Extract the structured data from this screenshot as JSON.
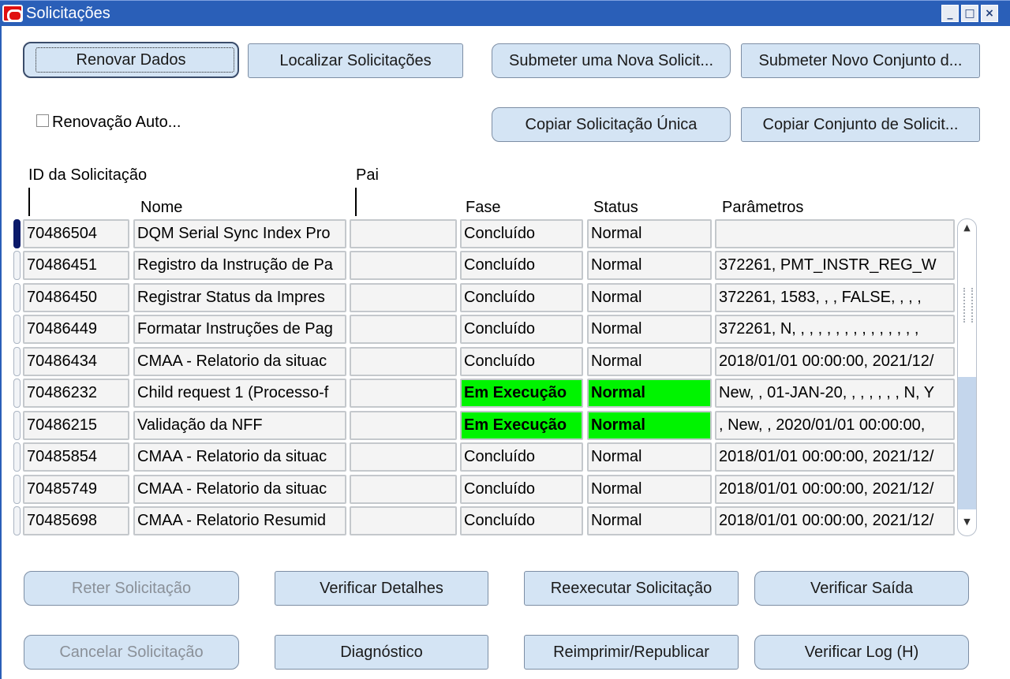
{
  "window": {
    "title": "Solicitações",
    "minimize_glyph": "_",
    "maximize_glyph": "□",
    "close_glyph": "×"
  },
  "buttons": {
    "renovar": "Renovar Dados",
    "localizar": "Localizar Solicitações",
    "submeter_nova": "Submeter uma Nova Solicit...",
    "submeter_conjunto": "Submeter Novo Conjunto d...",
    "copiar_unica": "Copiar Solicitação Única",
    "copiar_conjunto": "Copiar Conjunto de Solicit...",
    "reter": "Reter Solicitação",
    "verificar_detalhes": "Verificar Detalhes",
    "reexecutar": "Reexecutar Solicitação",
    "verificar_saida": "Verificar Saída",
    "cancelar": "Cancelar Solicitação",
    "diagnostico": "Diagnóstico",
    "reimprimir": "Reimprimir/Republicar",
    "verificar_log": "Verificar Log (H)"
  },
  "auto_refresh": {
    "label": "Renovação Auto...",
    "checked": false
  },
  "table": {
    "headers": {
      "id": "ID da Solicitação",
      "parent": "Pai",
      "name": "Nome",
      "phase": "Fase",
      "status": "Status",
      "params": "Parâmetros"
    },
    "rows": [
      {
        "id": "70486504",
        "name": "DQM Serial Sync Index Pro",
        "parent": "",
        "phase": "Concluído",
        "status": "Normal",
        "params": "",
        "running": false
      },
      {
        "id": "70486451",
        "name": "Registro da Instrução de Pa",
        "parent": "",
        "phase": "Concluído",
        "status": "Normal",
        "params": "372261, PMT_INSTR_REG_W",
        "running": false
      },
      {
        "id": "70486450",
        "name": "Registrar Status da Impres",
        "parent": "",
        "phase": "Concluído",
        "status": "Normal",
        "params": "372261, 1583, , , FALSE, , , ,",
        "running": false
      },
      {
        "id": "70486449",
        "name": "Formatar Instruções de Pag",
        "parent": "",
        "phase": "Concluído",
        "status": "Normal",
        "params": "372261, N, , , , , , , , , , , , , , ,",
        "running": false
      },
      {
        "id": "70486434",
        "name": "CMAA - Relatorio da situac",
        "parent": "",
        "phase": "Concluído",
        "status": "Normal",
        "params": "2018/01/01 00:00:00, 2021/12/",
        "running": false
      },
      {
        "id": "70486232",
        "name": "Child request 1 (Processo-f",
        "parent": "",
        "phase": "Em Execução",
        "status": "Normal",
        "params": "New, , 01-JAN-20, , , , , , , N, Y",
        "running": true
      },
      {
        "id": "70486215",
        "name": "Validação da NFF",
        "parent": "",
        "phase": "Em Execução",
        "status": "Normal",
        "params": ", New, , 2020/01/01 00:00:00,",
        "running": true
      },
      {
        "id": "70485854",
        "name": "CMAA - Relatorio da situac",
        "parent": "",
        "phase": "Concluído",
        "status": "Normal",
        "params": "2018/01/01 00:00:00, 2021/12/",
        "running": false
      },
      {
        "id": "70485749",
        "name": "CMAA - Relatorio da situac",
        "parent": "",
        "phase": "Concluído",
        "status": "Normal",
        "params": "2018/01/01 00:00:00, 2021/12/",
        "running": false
      },
      {
        "id": "70485698",
        "name": "CMAA - Relatorio Resumid",
        "parent": "",
        "phase": "Concluído",
        "status": "Normal",
        "params": "2018/01/01 00:00:00, 2021/12/",
        "running": false
      }
    ]
  },
  "icons": {
    "app": "oracle-icon",
    "up": "▲",
    "down": "▼"
  },
  "colors": {
    "titlebar": "#2a5fb8",
    "running": "#00f400",
    "button": "#d4e4f4"
  }
}
